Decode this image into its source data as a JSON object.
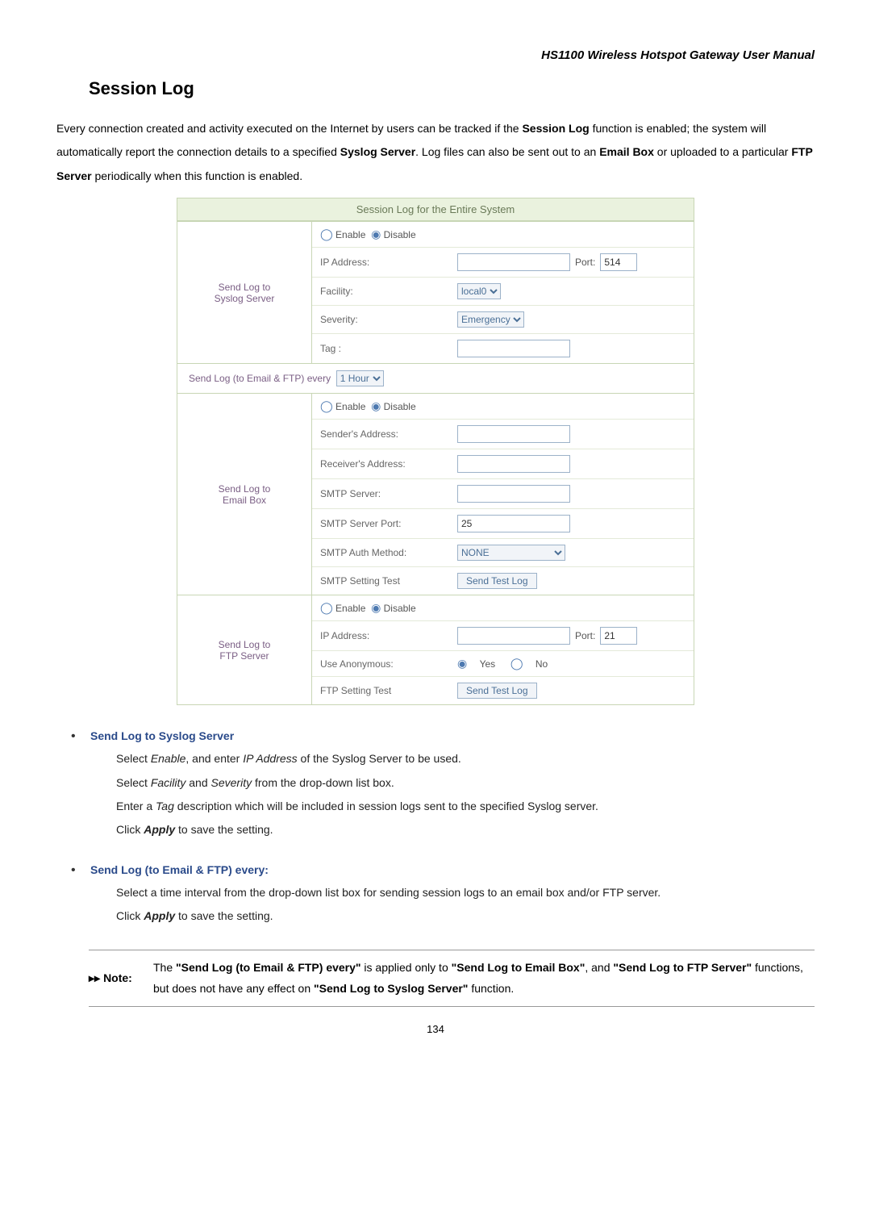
{
  "header": "HS1100 Wireless Hotspot Gateway User Manual",
  "title": "Session Log",
  "intro_parts": {
    "p1a": "Every connection created and activity executed on the Internet by users can be tracked if the ",
    "p1b": "Session Log",
    "p1c": " function is enabled; the system will automatically report the connection details to a specified ",
    "p1d": "Syslog Server",
    "p1e": ". Log files can also be sent out to an ",
    "p1f": "Email Box",
    "p1g": " or uploaded to a particular ",
    "p1h": "FTP Server",
    "p1i": " periodically when this function is enabled."
  },
  "shot": {
    "caption": "Session Log for the Entire System",
    "enable": "Enable",
    "disable": "Disable",
    "syslog": {
      "label": "Send Log to\nSyslog Server",
      "ip": "IP Address:",
      "port_lbl": "Port:",
      "port_val": "514",
      "facility": "Facility:",
      "facility_val": "local0",
      "severity": "Severity:",
      "severity_val": "Emergency",
      "tag": "Tag :"
    },
    "interval": {
      "label": "Send Log (to Email & FTP) every",
      "val": "1 Hour"
    },
    "email": {
      "label": "Send Log to\nEmail Box",
      "sender": "Sender's Address:",
      "receiver": "Receiver's Address:",
      "smtp": "SMTP Server:",
      "smtp_port": "SMTP Server Port:",
      "smtp_port_val": "25",
      "auth": "SMTP Auth Method:",
      "auth_val": "NONE",
      "test_lbl": "SMTP Setting Test",
      "test_btn": "Send Test Log"
    },
    "ftp": {
      "label": "Send Log to\nFTP Server",
      "ip": "IP Address:",
      "port_lbl": "Port:",
      "port_val": "21",
      "anon": "Use Anonymous:",
      "yes": "Yes",
      "no": "No",
      "test_lbl": "FTP Setting Test",
      "test_btn": "Send Test Log"
    }
  },
  "bullets": {
    "b1_title": "Send Log to Syslog Server",
    "b1_l1a": "Select ",
    "b1_l1b": "Enable",
    "b1_l1c": ", and enter ",
    "b1_l1d": "IP Address",
    "b1_l1e": " of the Syslog Server to be used.",
    "b1_l2a": "Select ",
    "b1_l2b": "Facility",
    "b1_l2c": " and ",
    "b1_l2d": "Severity",
    "b1_l2e": " from the drop-down list box.",
    "b1_l3a": "Enter a ",
    "b1_l3b": "Tag",
    "b1_l3c": " description which will be included in session logs sent to the specified Syslog server.",
    "b1_l4a": "Click ",
    "b1_l4b": "Apply",
    "b1_l4c": " to save the setting.",
    "b2_title": "Send Log (to Email & FTP) every:",
    "b2_l1": "Select a time interval from the drop-down list box for sending session logs to an email box and/or FTP server.",
    "b2_l2a": "Click ",
    "b2_l2b": "Apply",
    "b2_l2c": " to save the setting."
  },
  "note": {
    "label": "Note:",
    "t1": "The ",
    "t2": "\"Send Log (to Email & FTP) every\"",
    "t3": " is applied only to ",
    "t4": "\"Send Log to Email Box\"",
    "t5": ", and ",
    "t6": "\"Send Log to FTP Server\"",
    "t7": " functions, but does not have any effect on ",
    "t8": "\"Send Log to Syslog Server\"",
    "t9": " function."
  },
  "pagenum": "134"
}
